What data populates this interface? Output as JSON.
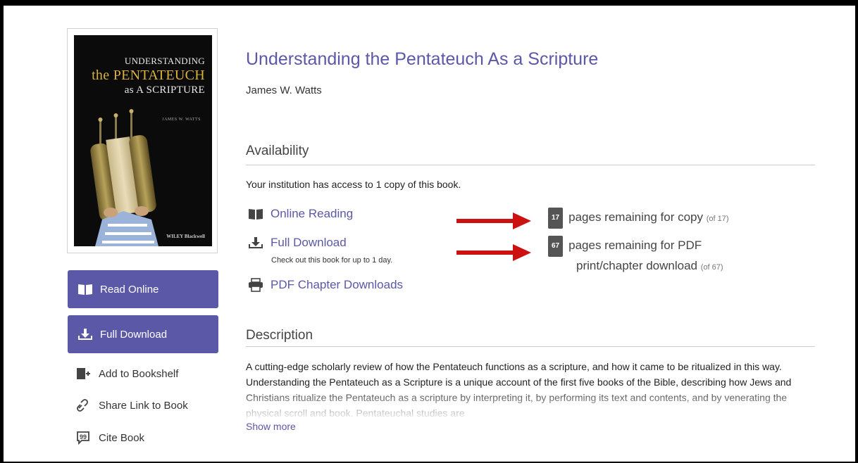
{
  "book": {
    "title": "Understanding the Pentateuch As a Scripture",
    "author": "James W. Watts",
    "cover": {
      "line1": "UNDERSTANDING",
      "line2": "the PENTATEUCH",
      "line3": "as A SCRIPTURE",
      "author": "JAMES W. WATTS",
      "publisher": "WILEY Blackwell"
    }
  },
  "sidebar": {
    "read_online": "Read Online",
    "full_download": "Full Download",
    "add_to_bookshelf": "Add to Bookshelf",
    "share_link": "Share Link to Book",
    "cite_book": "Cite Book"
  },
  "availability": {
    "heading": "Availability",
    "access_text": "Your institution has access to 1 copy of this book.",
    "online_reading": "Online Reading",
    "full_download": "Full Download",
    "full_download_note": "Check out this book for up to 1 day.",
    "pdf_chapters": "PDF Chapter Downloads",
    "copy_badge": "17",
    "copy_text": "pages remaining for copy",
    "copy_of": "(of 17)",
    "pdf_badge": "67",
    "pdf_text_line1": "pages remaining for PDF",
    "pdf_text_line2": "print/chapter download",
    "pdf_of": "(of 67)"
  },
  "description": {
    "heading": "Description",
    "text": "A cutting-edge scholarly review of how the Pentateuch functions as a scripture, and how it came to be ritualized in this way. Understanding the Pentateuch as a Scripture is a unique account of the first five books of the Bible, describing how Jews and Christians ritualize the Pentateuch as a scripture by interpreting it, by performing its text and contents, and by venerating the physical scroll and book. Pentateuchal studies are",
    "show_more": "Show more"
  },
  "colors": {
    "accent": "#5b58a8",
    "arrow": "#cc1111",
    "badge": "#555555"
  }
}
